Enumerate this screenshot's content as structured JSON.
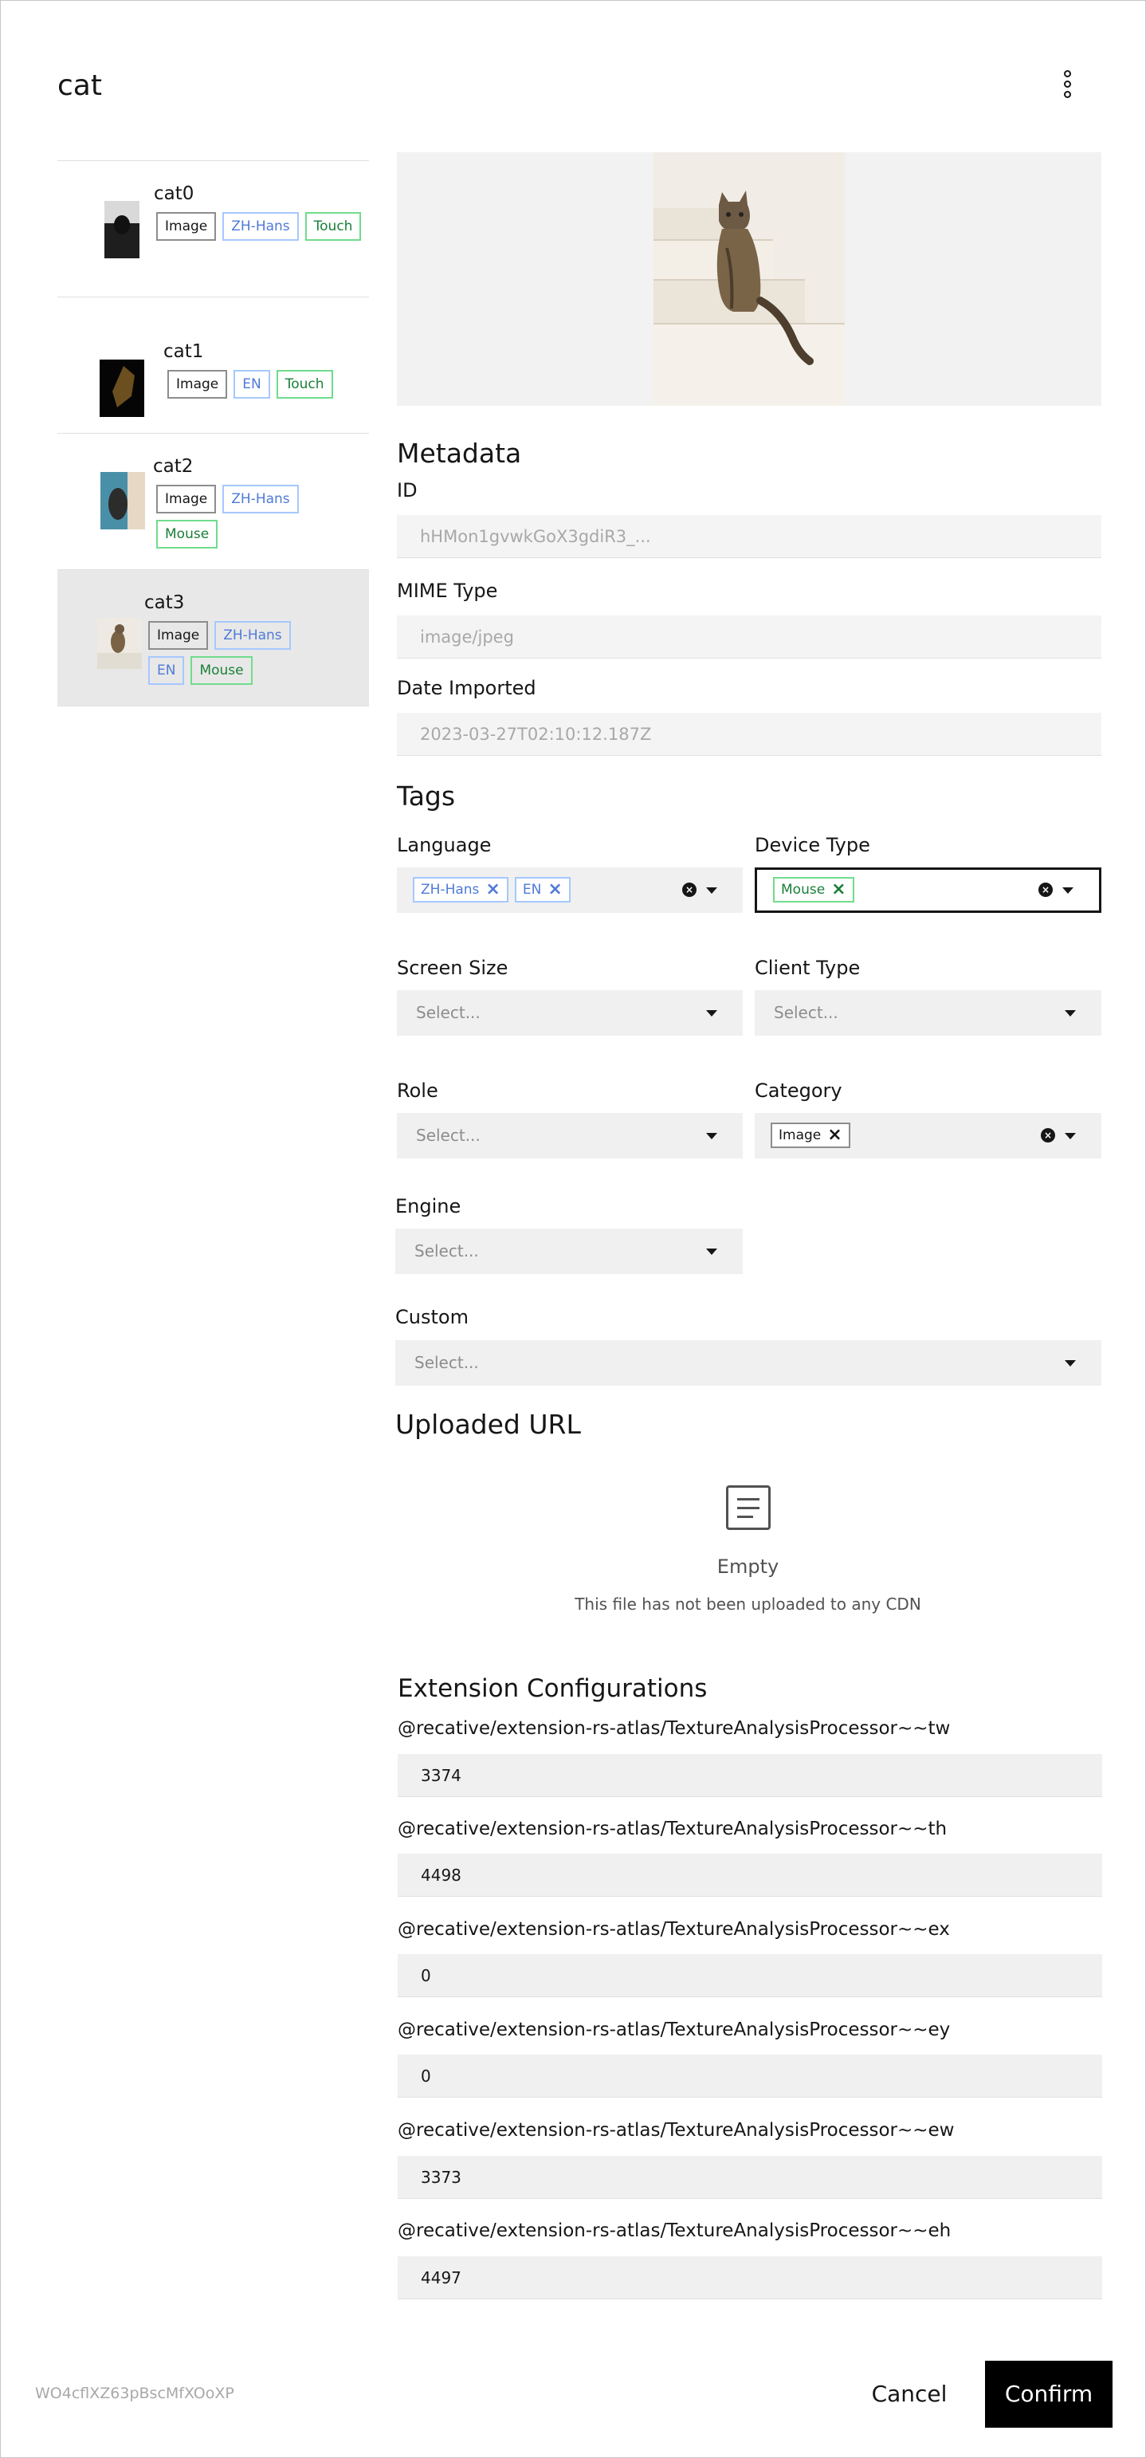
{
  "header": {
    "title": "cat"
  },
  "assets": [
    {
      "name": "cat0",
      "tags": [
        {
          "label": "Image",
          "color": "gray"
        },
        {
          "label": "ZH-Hans",
          "color": "blue"
        },
        {
          "label": "Touch",
          "color": "green"
        }
      ]
    },
    {
      "name": "cat1",
      "tags": [
        {
          "label": "Image",
          "color": "gray"
        },
        {
          "label": "EN",
          "color": "blue"
        },
        {
          "label": "Touch",
          "color": "green"
        }
      ]
    },
    {
      "name": "cat2",
      "tags": [
        {
          "label": "Image",
          "color": "gray"
        },
        {
          "label": "ZH-Hans",
          "color": "blue"
        },
        {
          "label": "Mouse",
          "color": "green"
        }
      ]
    },
    {
      "name": "cat3",
      "tags": [
        {
          "label": "Image",
          "color": "gray"
        },
        {
          "label": "ZH-Hans",
          "color": "blue"
        },
        {
          "label": "EN",
          "color": "blue"
        },
        {
          "label": "Mouse",
          "color": "green"
        }
      ]
    }
  ],
  "metadata": {
    "heading": "Metadata",
    "id_label": "ID",
    "id_value": "hHMon1gvwkGoX3gdiR3_...",
    "mime_label": "MIME Type",
    "mime_value": "image/jpeg",
    "date_label": "Date Imported",
    "date_value": "2023-03-27T02:10:12.187Z"
  },
  "tags_section": {
    "heading": "Tags",
    "language": {
      "label": "Language",
      "chips": [
        "ZH-Hans",
        "EN"
      ]
    },
    "device_type": {
      "label": "Device Type",
      "chips": [
        "Mouse"
      ]
    },
    "screen_size": {
      "label": "Screen Size",
      "placeholder": "Select..."
    },
    "client_type": {
      "label": "Client Type",
      "placeholder": "Select..."
    },
    "role": {
      "label": "Role",
      "placeholder": "Select..."
    },
    "category": {
      "label": "Category",
      "chips": [
        "Image"
      ]
    },
    "engine": {
      "label": "Engine",
      "placeholder": "Select..."
    },
    "custom": {
      "label": "Custom",
      "placeholder": "Select..."
    }
  },
  "uploaded_url": {
    "heading": "Uploaded URL",
    "empty_title": "Empty",
    "empty_subtitle": "This file has not been uploaded to any CDN"
  },
  "extensions": {
    "heading": "Extension Configurations",
    "fields": [
      {
        "label": "@recative/extension-rs-atlas/TextureAnalysisProcessor~~tw",
        "value": "3374"
      },
      {
        "label": "@recative/extension-rs-atlas/TextureAnalysisProcessor~~th",
        "value": "4498"
      },
      {
        "label": "@recative/extension-rs-atlas/TextureAnalysisProcessor~~ex",
        "value": "0"
      },
      {
        "label": "@recative/extension-rs-atlas/TextureAnalysisProcessor~~ey",
        "value": "0"
      },
      {
        "label": "@recative/extension-rs-atlas/TextureAnalysisProcessor~~ew",
        "value": "3373"
      },
      {
        "label": "@recative/extension-rs-atlas/TextureAnalysisProcessor~~eh",
        "value": "4497"
      }
    ]
  },
  "footer": {
    "id": "WO4cflXZ63pBscMfXOoXP",
    "cancel_label": "Cancel",
    "confirm_label": "Confirm"
  }
}
